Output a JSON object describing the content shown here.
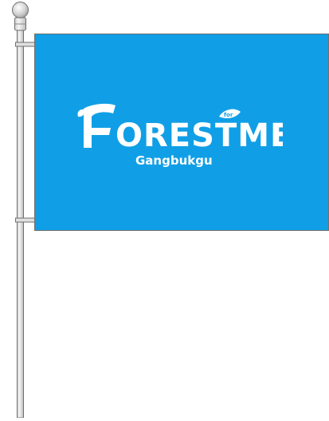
{
  "flag": {
    "color": "#109fe6",
    "text_color": "#ffffff",
    "logo": {
      "wordmark": "FORESTME",
      "small_word": "for",
      "subtitle": "Gangbukgu"
    }
  },
  "pole": {
    "color": "#e8e8e8",
    "outline": "#6f6f6f"
  }
}
